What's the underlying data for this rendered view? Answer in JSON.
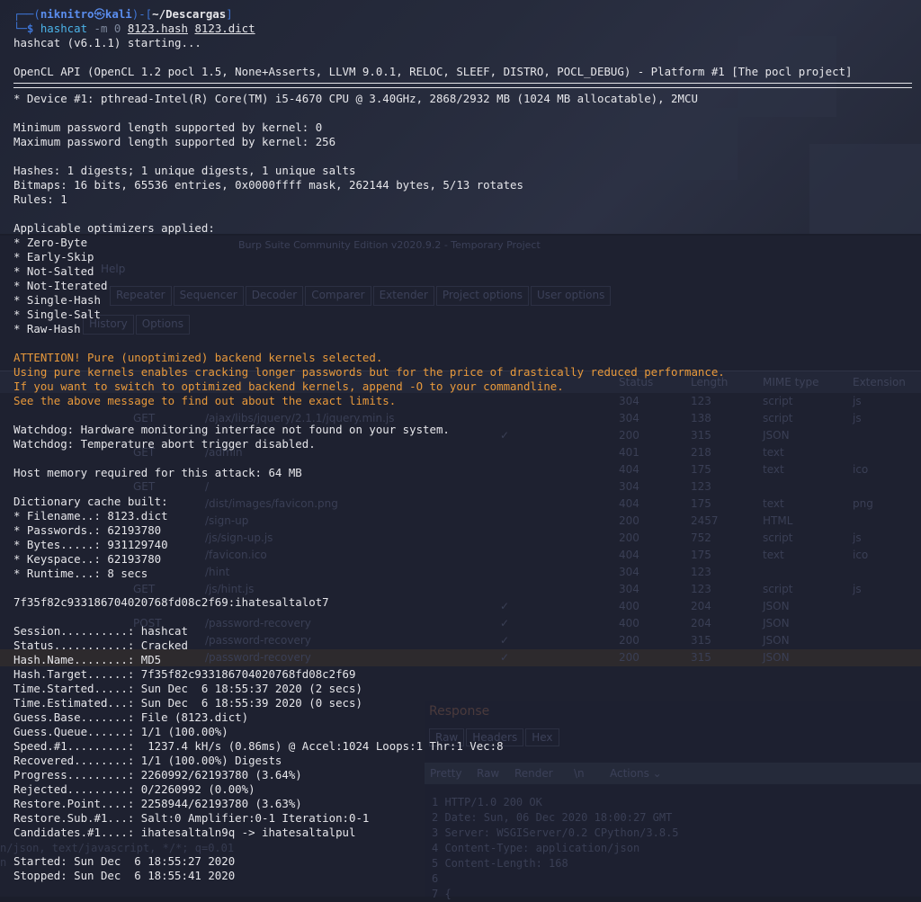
{
  "prompt": {
    "user": "niknitro",
    "host": "kali",
    "path": "~/Descargas",
    "command": "hashcat",
    "flag": "-m 0",
    "hash_file": "8123.hash",
    "dict_file": "8123.dict"
  },
  "header": {
    "starting": "hashcat (v6.1.1) starting...",
    "opencl": "OpenCL API (OpenCL 1.2 pocl 1.5, None+Asserts, LLVM 9.0.1, RELOC, SLEEF, DISTRO, POCL_DEBUG) - Platform #1 [The pocl project]",
    "device": "* Device #1: pthread-Intel(R) Core(TM) i5-4670 CPU @ 3.40GHz, 2868/2932 MB (1024 MB allocatable), 2MCU"
  },
  "kernel": {
    "min_len": "Minimum password length supported by kernel: 0",
    "max_len": "Maximum password length supported by kernel: 256"
  },
  "hashes": {
    "digests": "Hashes: 1 digests; 1 unique digests, 1 unique salts",
    "bitmaps": "Bitmaps: 16 bits, 65536 entries, 0x0000ffff mask, 262144 bytes, 5/13 rotates",
    "rules": "Rules: 1"
  },
  "optimizers": {
    "title": "Applicable optimizers applied:",
    "items": [
      "* Zero-Byte",
      "* Early-Skip",
      "* Not-Salted",
      "* Not-Iterated",
      "* Single-Hash",
      "* Single-Salt",
      "* Raw-Hash"
    ]
  },
  "attention": [
    "ATTENTION! Pure (unoptimized) backend kernels selected.",
    "Using pure kernels enables cracking longer passwords but for the price of drastically reduced performance.",
    "If you want to switch to optimized backend kernels, append -O to your commandline.",
    "See the above message to find out about the exact limits."
  ],
  "watchdog": [
    "Watchdog: Hardware monitoring interface not found on your system.",
    "Watchdog: Temperature abort trigger disabled."
  ],
  "memory": "Host memory required for this attack: 64 MB",
  "dictionary": {
    "title": "Dictionary cache built:",
    "items": [
      "* Filename..: 8123.dict",
      "* Passwords.: 62193780",
      "* Bytes.....: 931129740",
      "* Keyspace..: 62193780",
      "* Runtime...: 8 secs"
    ]
  },
  "result": "7f35f82c933186704020768fd08c2f69:ihatesaltalot7",
  "status": [
    "Session..........: hashcat",
    "Status...........: Cracked",
    "Hash.Name........: MD5",
    "Hash.Target......: 7f35f82c933186704020768fd08c2f69",
    "Time.Started.....: Sun Dec  6 18:55:37 2020 (2 secs)",
    "Time.Estimated...: Sun Dec  6 18:55:39 2020 (0 secs)",
    "Guess.Base.......: File (8123.dict)",
    "Guess.Queue......: 1/1 (100.00%)",
    "Speed.#1.........:  1237.4 kH/s (0.86ms) @ Accel:1024 Loops:1 Thr:1 Vec:8",
    "Recovered........: 1/1 (100.00%) Digests",
    "Progress.........: 2260992/62193780 (3.64%)",
    "Rejected.........: 0/2260992 (0.00%)",
    "Restore.Point....: 2258944/62193780 (3.63%)",
    "Restore.Sub.#1...: Salt:0 Amplifier:0-1 Iteration:0-1",
    "Candidates.#1....: ihatesaltaln9q -> ihatesaltalpul"
  ],
  "footer": {
    "started": "Started: Sun Dec  6 18:55:27 2020",
    "stopped": "Stopped: Sun Dec  6 18:55:41 2020"
  },
  "background_app": {
    "title": "Burp Suite Community Edition v2020.9.2 - Temporary Project",
    "menu": "Help",
    "tabs": [
      "Repeater",
      "Sequencer",
      "Decoder",
      "Comparer",
      "Extender",
      "Project options",
      "User options"
    ],
    "subtabs": [
      "History",
      "Options"
    ],
    "columns": [
      "Status",
      "Length",
      "MIME type",
      "Extension"
    ],
    "rows": [
      {
        "method": "",
        "url": "",
        "check": "",
        "status": "304",
        "length": "123",
        "mime": "script",
        "ext": "js"
      },
      {
        "method": "GET",
        "url": "/ajax/libs/jquery/2.1.1/jquery.min.js",
        "check": "",
        "status": "304",
        "length": "138",
        "mime": "script",
        "ext": "js"
      },
      {
        "method": "",
        "url": "",
        "check": "✓",
        "status": "200",
        "length": "315",
        "mime": "JSON",
        "ext": ""
      },
      {
        "method": "GET",
        "url": "/admin",
        "check": "",
        "status": "401",
        "length": "218",
        "mime": "text",
        "ext": ""
      },
      {
        "method": "",
        "url": "",
        "check": "",
        "status": "404",
        "length": "175",
        "mime": "text",
        "ext": "ico"
      },
      {
        "method": "GET",
        "url": "/",
        "check": "",
        "status": "304",
        "length": "123",
        "mime": "",
        "ext": ""
      },
      {
        "method": "",
        "url": "/dist/images/favicon.png",
        "check": "",
        "status": "404",
        "length": "175",
        "mime": "text",
        "ext": "png"
      },
      {
        "method": "",
        "url": "/sign-up",
        "check": "",
        "status": "200",
        "length": "2457",
        "mime": "HTML",
        "ext": ""
      },
      {
        "method": "",
        "url": "/js/sign-up.js",
        "check": "",
        "status": "200",
        "length": "752",
        "mime": "script",
        "ext": "js"
      },
      {
        "method": "",
        "url": "/favicon.ico",
        "check": "",
        "status": "404",
        "length": "175",
        "mime": "text",
        "ext": "ico"
      },
      {
        "method": "",
        "url": "/hint",
        "check": "",
        "status": "304",
        "length": "123",
        "mime": "",
        "ext": ""
      },
      {
        "method": "GET",
        "url": "/js/hint.js",
        "check": "",
        "status": "304",
        "length": "123",
        "mime": "script",
        "ext": "js"
      },
      {
        "method": "",
        "url": "",
        "check": "✓",
        "status": "400",
        "length": "204",
        "mime": "JSON",
        "ext": ""
      },
      {
        "method": "POST",
        "url": "/password-recovery",
        "check": "✓",
        "status": "400",
        "length": "204",
        "mime": "JSON",
        "ext": ""
      },
      {
        "method": "",
        "url": "/password-recovery",
        "check": "✓",
        "status": "200",
        "length": "315",
        "mime": "JSON",
        "ext": ""
      },
      {
        "method": "",
        "url": "/password-recovery",
        "check": "✓",
        "status": "200",
        "length": "315",
        "mime": "JSON",
        "ext": ""
      }
    ],
    "response": {
      "title": "Response",
      "tabs": [
        "Raw",
        "Headers",
        "Hex"
      ],
      "view_tabs": [
        "Pretty",
        "Raw",
        "Render",
        "\\n",
        "Actions ⌄"
      ],
      "lines": [
        "1 HTTP/1.0 200 OK",
        "2 Date: Sun, 06 Dec 2020 18:00:27 GMT",
        "3 Server: WSGIServer/0.2 CPython/3.8.5",
        "4 Content-Type: application/json",
        "5 Content-Length: 168",
        "6",
        "7 {"
      ]
    },
    "request_lines": [
      "n/json, text/javascript, */*; q=0.01",
      "n"
    ]
  },
  "colors": {
    "terminal_bg": "#1b1e2b",
    "text": "#e6e6ea",
    "prompt_blue": "#3e75d6",
    "command_cyan": "#4bb3e8",
    "warning_orange": "#e8993b"
  }
}
